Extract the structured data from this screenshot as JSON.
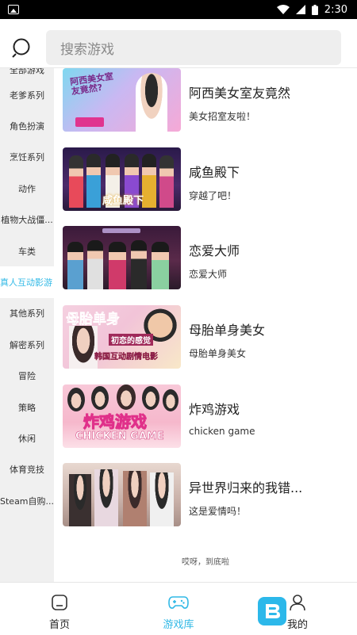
{
  "status": {
    "time": "2:30"
  },
  "search": {
    "placeholder": "搜索游戏"
  },
  "sidebar": {
    "items": [
      {
        "label": "全部游戏"
      },
      {
        "label": "老爹系列"
      },
      {
        "label": "角色扮演"
      },
      {
        "label": "烹饪系列"
      },
      {
        "label": "动作"
      },
      {
        "label": "植物大战僵..."
      },
      {
        "label": "车类"
      },
      {
        "label": "真人互动影游"
      },
      {
        "label": "其他系列"
      },
      {
        "label": "解密系列"
      },
      {
        "label": "冒险"
      },
      {
        "label": "策略"
      },
      {
        "label": "休闲"
      },
      {
        "label": "体育竞技"
      },
      {
        "label": "Steam自购..."
      }
    ],
    "active_index": 7
  },
  "games": [
    {
      "title": "阿西美女室友竟然",
      "subtitle": "美女招室友啦！",
      "thumb_text": "阿西美女室友竟然?"
    },
    {
      "title": "咸鱼殿下",
      "subtitle": "穿越了吧！",
      "thumb_text": "咸鱼殿下"
    },
    {
      "title": "恋爱大师",
      "subtitle": "恋爱大师",
      "thumb_text": ""
    },
    {
      "title": "母胎单身美女",
      "subtitle": "母胎单身美女",
      "thumb_text": "母胎单身",
      "thumb_text2": "初恋的感觉",
      "thumb_text3": "韩国互动剧情电影"
    },
    {
      "title": "炸鸡游戏",
      "subtitle": "chicken game",
      "thumb_text": "炸鸡游戏",
      "thumb_text2": "CHICKEN GAME"
    },
    {
      "title": "异世界归来的我错...",
      "subtitle": "这是爱情吗！",
      "thumb_text": ""
    }
  ],
  "end_note": "哎呀，到底啦",
  "nav": {
    "items": [
      {
        "label": "首页"
      },
      {
        "label": "游戏库"
      },
      {
        "label": "我的"
      }
    ],
    "active_index": 1
  },
  "colors": {
    "accent": "#31b9e6",
    "sidebar_bg": "#f0f0f0",
    "search_bg": "#eeeeee"
  }
}
